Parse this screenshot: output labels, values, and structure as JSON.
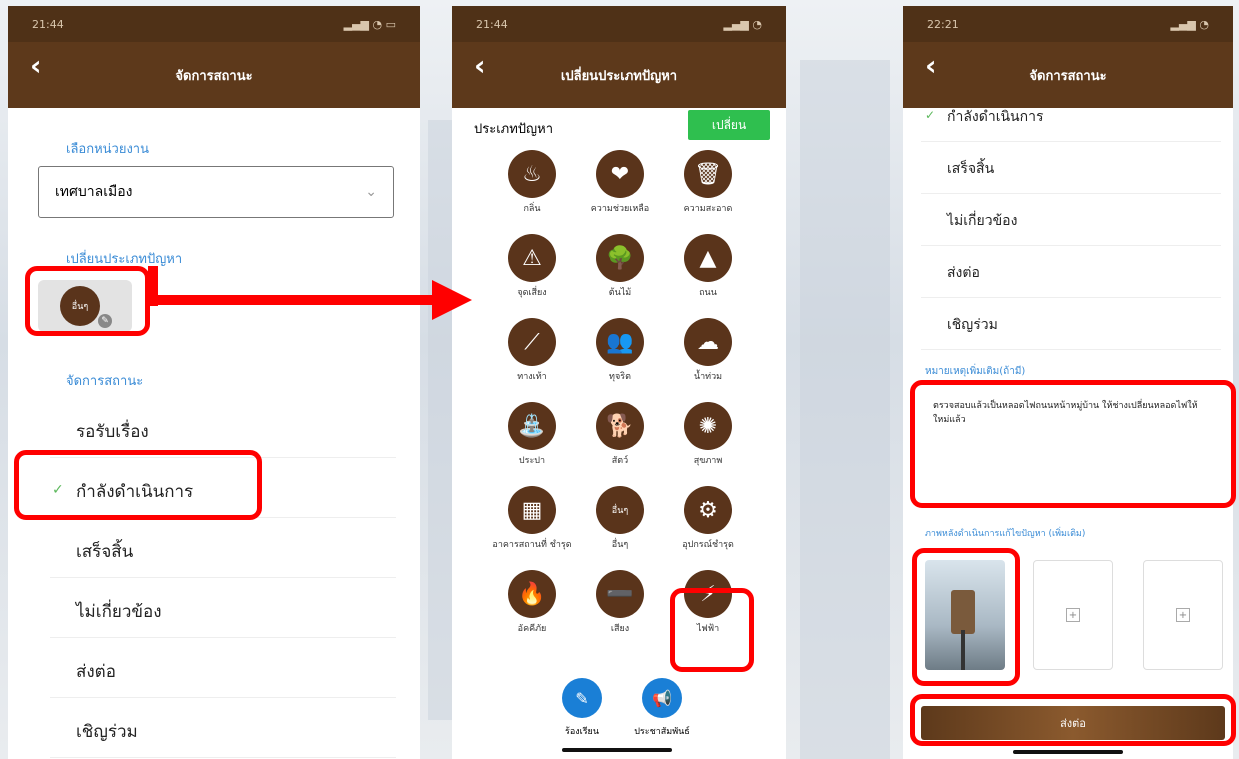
{
  "screen1": {
    "status_time": "21:44",
    "title": "จัดการสถานะ",
    "dept_label": "เลือกหน่วยงาน",
    "dept_value": "เทศบาลเมือง",
    "change_type_label": "เปลี่ยนประเภทปัญหา",
    "current_type_icon": "อื่นๆ",
    "manage_label": "จัดการสถานะ",
    "statuses": [
      "รอรับเรื่อง",
      "กำลังดำเนินการ",
      "เสร็จสิ้น",
      "ไม่เกี่ยวข้อง",
      "ส่งต่อ",
      "เชิญร่วม"
    ]
  },
  "screen2": {
    "status_time": "21:44",
    "title": "เปลี่ยนประเภทปัญหา",
    "heading": "ประเภทปัญหา",
    "change_button": "เปลี่ยน",
    "categories": [
      {
        "label": "กลิ่น",
        "icon": "fire-icon"
      },
      {
        "label": "ความช่วยเหลือ",
        "icon": "heart-hand-icon"
      },
      {
        "label": "ความสะอาด",
        "icon": "trash-icon"
      },
      {
        "label": "จุดเสี่ยง",
        "icon": "warning-icon"
      },
      {
        "label": "ต้นไม้",
        "icon": "tree-icon"
      },
      {
        "label": "ถนน",
        "icon": "road-icon"
      },
      {
        "label": "ทางเท้า",
        "icon": "sidewalk-icon"
      },
      {
        "label": "ทุจริต",
        "icon": "people-icon"
      },
      {
        "label": "น้ำท่วม",
        "icon": "flood-icon"
      },
      {
        "label": "ประปา",
        "icon": "tap-icon"
      },
      {
        "label": "สัตว์",
        "icon": "dog-icon"
      },
      {
        "label": "สุขภาพ",
        "icon": "health-icon"
      },
      {
        "label": "อาคารสถานที่ ชำรุด",
        "icon": "building-icon"
      },
      {
        "label": "อื่นๆ",
        "icon": "other-icon"
      },
      {
        "label": "อุปกรณ์ชำรุด",
        "icon": "broken-icon"
      },
      {
        "label": "อัคคีภัย",
        "icon": "flame-icon"
      },
      {
        "label": "เสียง",
        "icon": "sound-icon"
      },
      {
        "label": "ไฟฟ้า",
        "icon": "lightning-icon"
      }
    ],
    "bottom": [
      {
        "label": "ร้องเรียน",
        "icon": "complaint-icon"
      },
      {
        "label": "ประชาสัมพันธ์",
        "icon": "megaphone-icon"
      }
    ]
  },
  "screen3": {
    "status_time": "22:21",
    "title": "จัดการสถานะ",
    "statuses": [
      "กำลังดำเนินการ",
      "เสร็จสิ้น",
      "ไม่เกี่ยวข้อง",
      "ส่งต่อ",
      "เชิญร่วม"
    ],
    "note_label": "หมายเหตุเพิ่มเติม(ถ้ามี)",
    "note_text": "ตรวจสอบแล้วเป็นหลอดไฟถนนหน้าหมู่บ้าน ให้ช่างเปลี่ยนหลอดไฟให้ใหม่แล้ว",
    "photo_label": "ภาพหลังดำเนินการแก้ไขปัญหา (เพิ่มเติม)",
    "submit": "ส่งต่อ"
  },
  "colors": {
    "brown": "#5d391b",
    "highlight": "#ff0000",
    "green": "#2fbf4f",
    "blue": "#1a7fd6"
  }
}
